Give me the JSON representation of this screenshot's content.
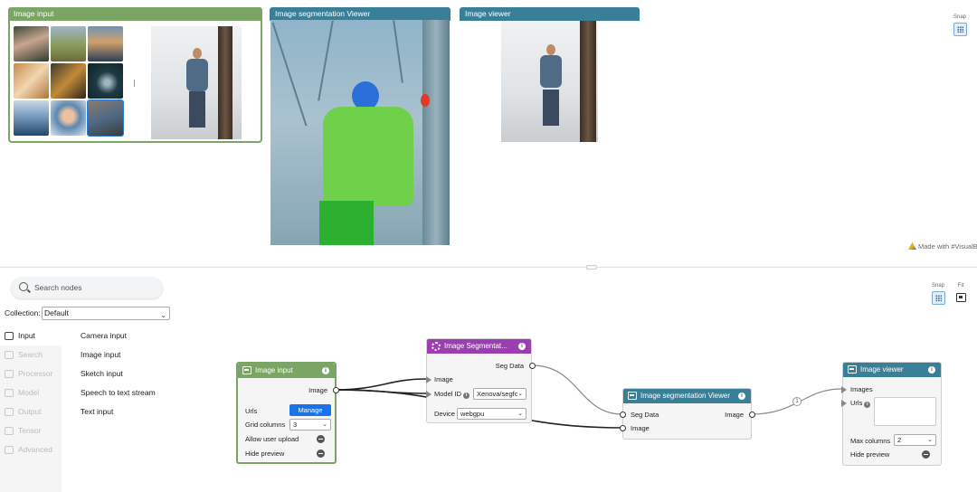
{
  "preview": {
    "image_input": {
      "title": "Image input"
    },
    "seg_viewer": {
      "title": "Image segmentation Viewer"
    },
    "image_viewer": {
      "title": "Image viewer"
    },
    "made_with": "Made with #VisualB",
    "snap_label": "Snap"
  },
  "toolbar": {
    "snap_label": "Snap",
    "fit_label": "Fit"
  },
  "sidebar": {
    "search_placeholder": "Search nodes",
    "collection_label": "Collection:",
    "collection_value": "Default",
    "categories": [
      {
        "label": "Input",
        "active": true
      },
      {
        "label": "Search"
      },
      {
        "label": "Processor"
      },
      {
        "label": "Model"
      },
      {
        "label": "Output"
      },
      {
        "label": "Tensor"
      },
      {
        "label": "Advanced"
      }
    ],
    "items": [
      "Camera input",
      "Image input",
      "Sketch input",
      "Speech to text stream",
      "Text input"
    ]
  },
  "nodes": {
    "image_input": {
      "title": "Image input",
      "output_image": "Image",
      "urls_label": "Urls",
      "manage_label": "Manage",
      "grid_columns_label": "Grid columns",
      "grid_columns_value": "3",
      "allow_upload_label": "Allow user upload",
      "hide_preview_label": "Hide preview"
    },
    "segmenter": {
      "title": "Image Segmentat...",
      "seg_data_label": "Seg Data",
      "image_label": "Image",
      "model_id_label": "Model ID",
      "model_id_value": "Xenova/segfc",
      "device_label": "Device",
      "device_value": "webgpu"
    },
    "seg_viewer": {
      "title": "Image segmentation Viewer",
      "seg_data_label": "Seg Data",
      "image_in_label": "Image",
      "image_out_label": "Image"
    },
    "image_viewer": {
      "title": "Image viewer",
      "images_label": "Images",
      "urls_label": "Urls",
      "max_columns_label": "Max columns",
      "max_columns_value": "2",
      "hide_preview_label": "Hide preview"
    },
    "edge_badge": "1"
  }
}
